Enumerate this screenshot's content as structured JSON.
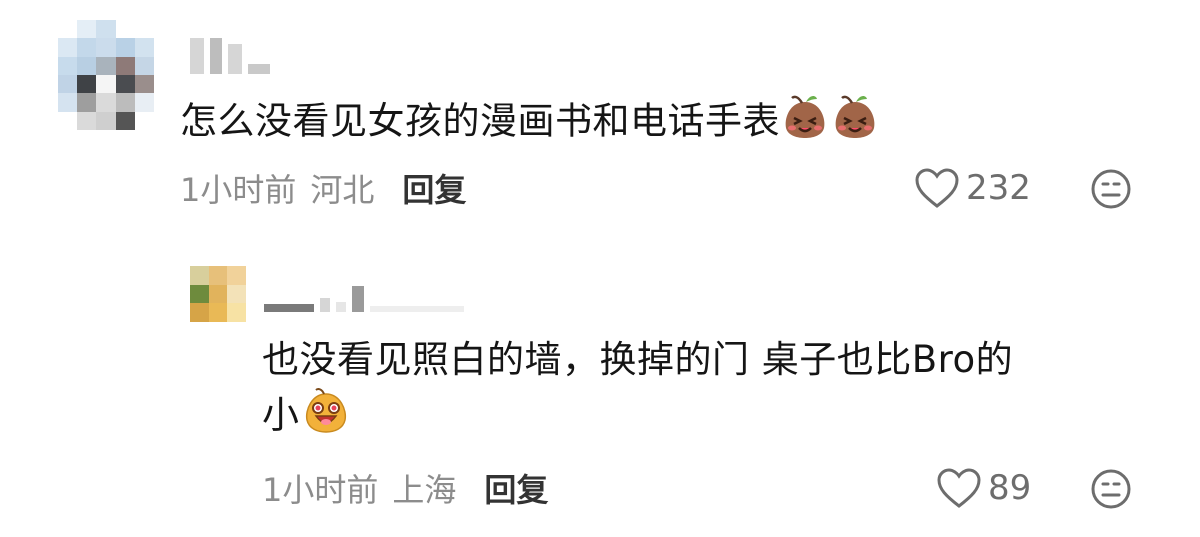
{
  "comments": [
    {
      "text": "怎么没看见女孩的漫画书和电话手表",
      "time": "1小时前",
      "location": "河北",
      "reply_label": "回复",
      "likes": "232",
      "emojis": [
        "smirk-bean-icon",
        "smirk-bean-icon"
      ]
    },
    {
      "text_line1": "也没看见照白的墙，换掉的门 桌子也比Bro的",
      "text_line2": "小",
      "time": "1小时前",
      "location": "上海",
      "reply_label": "回复",
      "likes": "89",
      "emojis": [
        "happy-bean-icon"
      ]
    }
  ],
  "colors": {
    "meta_text": "#8c8c8c",
    "reply_text": "#333333",
    "body_text": "#151515",
    "icon_stroke": "#6d6d6d"
  }
}
